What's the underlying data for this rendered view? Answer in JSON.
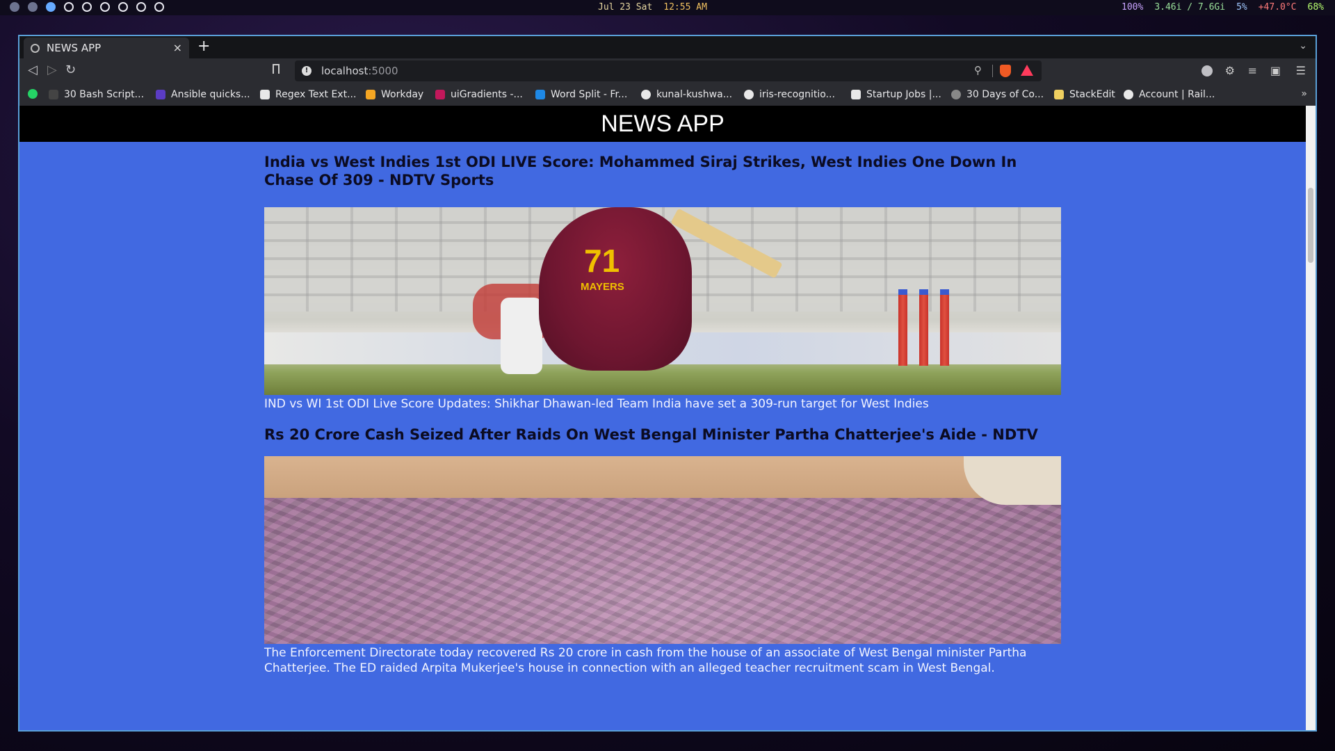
{
  "system_bar": {
    "date": "Jul 23 Sat",
    "time": "12:55 AM",
    "volume": "100%",
    "memory": "3.46i / 7.6Gi",
    "cpu": "5%",
    "temperature": "+47.0°C",
    "battery": "68%"
  },
  "browser": {
    "tab_title": "NEWS APP",
    "tab_close": "×",
    "new_tab": "+",
    "url_host": "localhost",
    "url_port": ":5000",
    "bookmarks": [
      {
        "label": "30 Bash Script...",
        "color": "#444"
      },
      {
        "label": "Ansible quicks...",
        "color": "#5b3cc4"
      },
      {
        "label": "Regex Text Ext...",
        "color": "#e8e8e8"
      },
      {
        "label": "Workday",
        "color": "#f5a623"
      },
      {
        "label": "uiGradients -...",
        "color": "#c2185b"
      },
      {
        "label": "Word Split - Fr...",
        "color": "#1e88e5"
      },
      {
        "label": "kunal-kushwa...",
        "color": "#e8e8e8"
      },
      {
        "label": "iris-recognitio...",
        "color": "#e8e8e8"
      },
      {
        "label": "Startup Jobs |...",
        "color": "#e8e8e8"
      },
      {
        "label": "30 Days of Co...",
        "color": "#888"
      },
      {
        "label": "StackEdit",
        "color": "#f0d060"
      },
      {
        "label": "Account | Rail...",
        "color": "#e8e8e8"
      }
    ],
    "bookmarks_more": "»"
  },
  "page": {
    "header": "NEWS APP",
    "articles": [
      {
        "title": "India vs West Indies 1st ODI LIVE Score: Mohammed Siraj Strikes, West Indies One Down In Chase Of 309 - NDTV Sports",
        "description": "IND vs WI 1st ODI Live Score Updates: Shikhar Dhawan-led Team India have set a 309-run target for West Indies",
        "image_text": {
          "number": "71",
          "name": "MAYERS"
        }
      },
      {
        "title": "Rs 20 Crore Cash Seized After Raids On West Bengal Minister Partha Chatterjee's Aide - NDTV",
        "description": "The Enforcement Directorate today recovered Rs 20 crore in cash from the house of an associate of West Bengal minister Partha Chatterjee. The ED raided Arpita Mukerjee's house in connection with an alleged teacher recruitment scam in West Bengal."
      }
    ]
  },
  "colors": {
    "page_background": "#4169e1",
    "header_background": "#000000",
    "title_color": "#0b0b22"
  }
}
